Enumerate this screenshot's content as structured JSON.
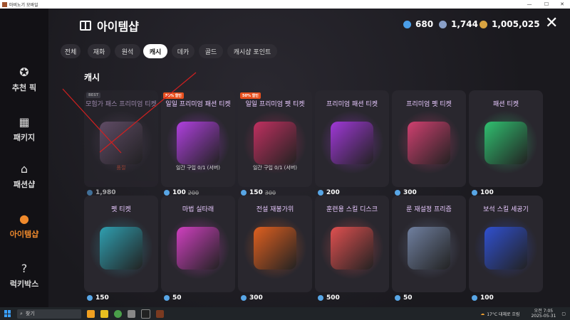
{
  "window": {
    "title": "마비노기 모바일"
  },
  "sidebar": {
    "items": [
      {
        "label": "추천 픽",
        "icon": "star-badge-icon",
        "active": false
      },
      {
        "label": "패키지",
        "icon": "package-icon",
        "active": false
      },
      {
        "label": "패션샵",
        "icon": "hanger-icon",
        "active": false
      },
      {
        "label": "아이템샵",
        "icon": "pouch-icon",
        "active": true
      },
      {
        "label": "럭키박스",
        "icon": "lucky-box-icon",
        "active": false
      }
    ]
  },
  "header": {
    "title": "아이템샵",
    "title_icon": "gift-icon"
  },
  "currencies": [
    {
      "value": "680",
      "icon": "gem-icon",
      "color": "#4a9ee8"
    },
    {
      "value": "1,744",
      "icon": "silver-gem-icon",
      "color": "#8aa0c8"
    },
    {
      "value": "1,005,025",
      "icon": "gold-coin-icon",
      "color": "#d9a441"
    }
  ],
  "tabs": [
    {
      "label": "전체",
      "active": false
    },
    {
      "label": "재화",
      "active": false
    },
    {
      "label": "원석",
      "active": false
    },
    {
      "label": "캐시",
      "active": true
    },
    {
      "label": "데카",
      "active": false
    },
    {
      "label": "골드",
      "active": false
    },
    {
      "label": "캐시샵 포인트",
      "active": false
    }
  ],
  "section_title": "캐시",
  "items": [
    {
      "name": "모험가 패스 프리미엄 티켓",
      "badge": "BEST",
      "status": "품절",
      "price": "1,980",
      "old_price": "",
      "sub": "",
      "color": "#8a6a90",
      "sold_out": true
    },
    {
      "name": "일일 프리미엄 패션 티켓",
      "badge": "50% 할인",
      "status": "",
      "price": "100",
      "old_price": "200",
      "sub": "일간 구입 0/1 (서버)",
      "color": "#b040e0",
      "sold_out": false
    },
    {
      "name": "일일 프리미엄 펫 티켓",
      "badge": "50% 할인",
      "status": "",
      "price": "150",
      "old_price": "300",
      "sub": "일간 구입 0/1 (서버)",
      "color": "#c03060",
      "sold_out": false
    },
    {
      "name": "프리미엄 패션 티켓",
      "badge": "",
      "status": "",
      "price": "200",
      "old_price": "",
      "sub": "",
      "color": "#a038d8",
      "sold_out": false
    },
    {
      "name": "프리미엄 펫 티켓",
      "badge": "",
      "status": "",
      "price": "300",
      "old_price": "",
      "sub": "",
      "color": "#d04070",
      "sold_out": false
    },
    {
      "name": "패션 티켓",
      "badge": "",
      "status": "",
      "price": "100",
      "old_price": "",
      "sub": "",
      "color": "#30c070",
      "sold_out": false
    },
    {
      "name": "펫 티켓",
      "badge": "",
      "status": "",
      "price": "150",
      "old_price": "",
      "sub": "",
      "color": "#2f9fb0",
      "sold_out": false
    },
    {
      "name": "마법 실타래",
      "badge": "",
      "status": "",
      "price": "50",
      "old_price": "",
      "sub": "",
      "color": "#d040c0",
      "sold_out": false
    },
    {
      "name": "전설 재봉가위",
      "badge": "",
      "status": "",
      "price": "300",
      "old_price": "",
      "sub": "",
      "color": "#e06020",
      "sold_out": false
    },
    {
      "name": "훈련용 스킬 디스크",
      "badge": "",
      "status": "",
      "price": "500",
      "old_price": "",
      "sub": "",
      "color": "#e05050",
      "sold_out": false
    },
    {
      "name": "룬 재설정 프리즘",
      "badge": "",
      "status": "",
      "price": "50",
      "old_price": "",
      "sub": "",
      "color": "#7080a0",
      "sold_out": false
    },
    {
      "name": "보석 스킬 세공기",
      "badge": "",
      "status": "",
      "price": "100",
      "old_price": "",
      "sub": "",
      "color": "#3050d0",
      "sold_out": false
    }
  ],
  "taskbar": {
    "search_placeholder": "찾기",
    "weather": "17°C 대체로 흐림",
    "time": "오전 7:05",
    "date": "2025-05-31"
  }
}
